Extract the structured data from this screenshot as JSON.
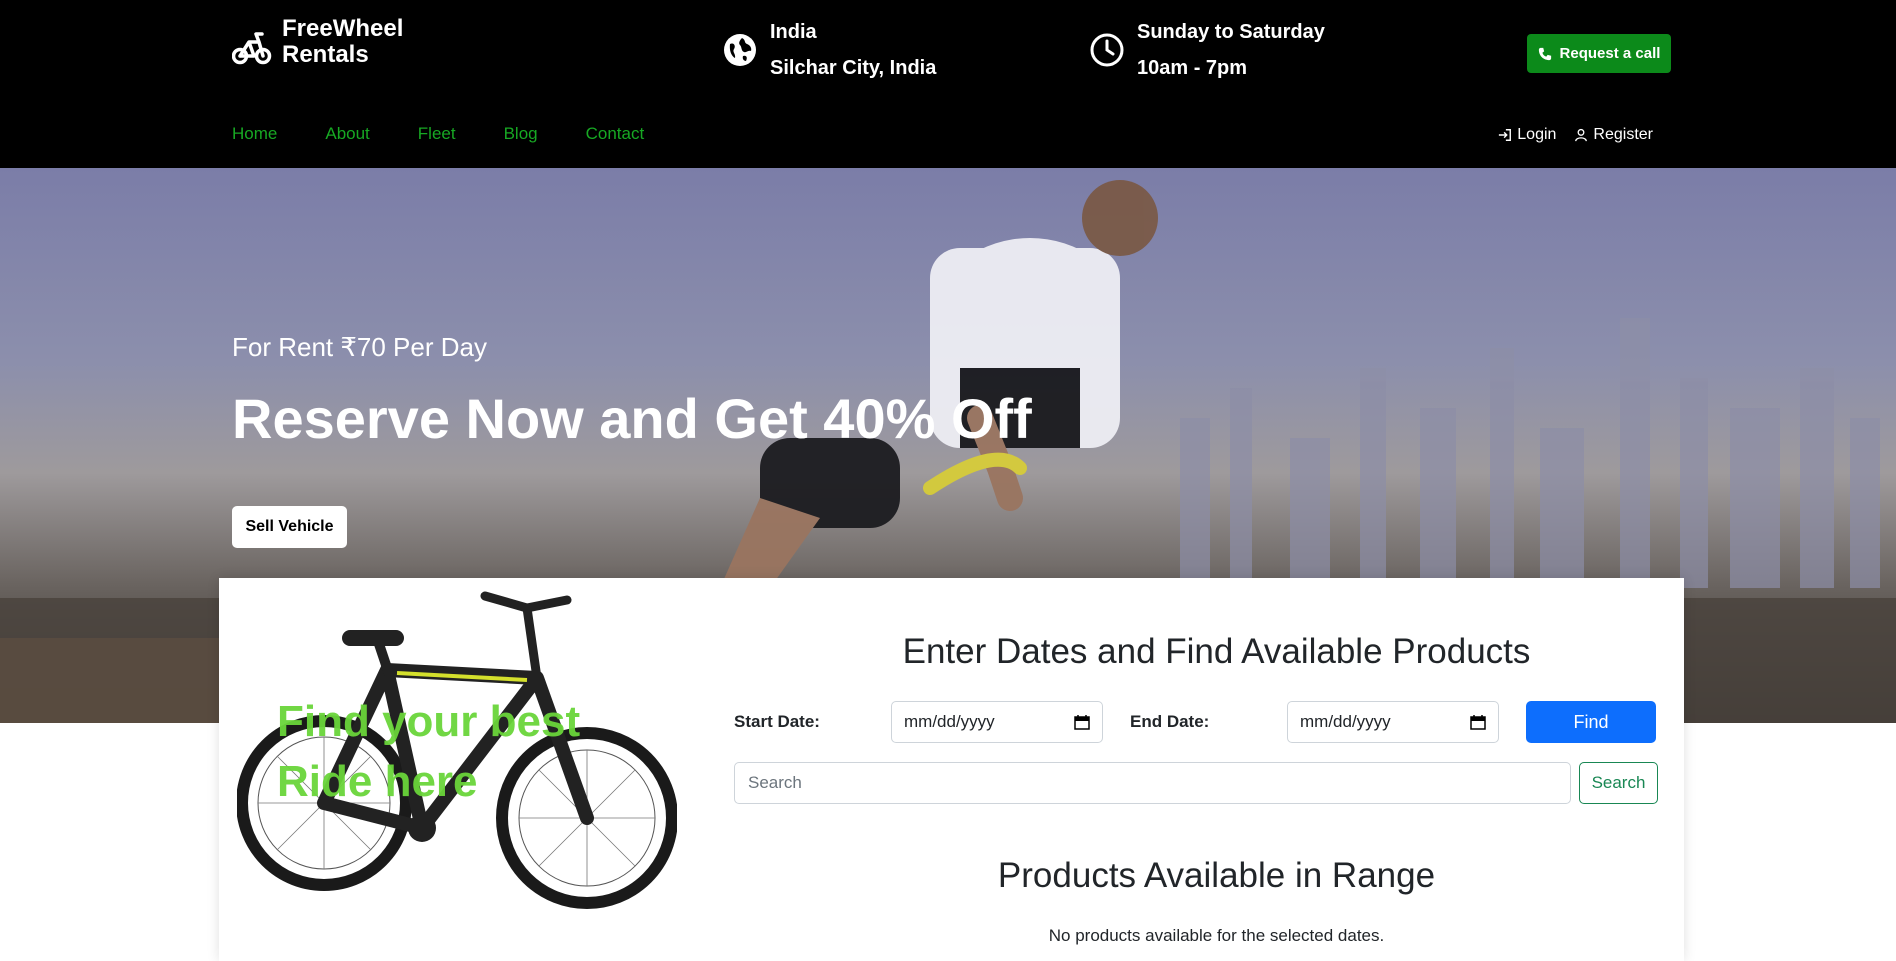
{
  "brand": {
    "name": "FreeWheel Rentals",
    "icon": "bicycle-icon"
  },
  "location": {
    "country": "India",
    "city": "Silchar City, India",
    "icon": "globe-icon"
  },
  "hours": {
    "days": "Sunday to Saturday",
    "time": "10am - 7pm",
    "icon": "clock-icon"
  },
  "header": {
    "call_label": "Request a call",
    "call_icon": "phone-icon"
  },
  "nav": {
    "items": [
      {
        "label": "Home"
      },
      {
        "label": "About"
      },
      {
        "label": "Fleet"
      },
      {
        "label": "Blog"
      },
      {
        "label": "Contact"
      }
    ]
  },
  "auth": {
    "login": "Login",
    "register": "Register"
  },
  "hero": {
    "subtitle": "For Rent ₹70 Per Day",
    "title": "Reserve Now and Get 40% Off",
    "sell_label": "Sell Vehicle"
  },
  "finder": {
    "image_caption": "Find your best Ride here",
    "title": "Enter Dates and Find Available Products",
    "start_label": "Start Date:",
    "start_placeholder": "mm/dd/yyyy",
    "end_label": "End Date:",
    "end_placeholder": "mm/dd/yyyy",
    "find_label": "Find",
    "search_placeholder": "Search",
    "search_label": "Search"
  },
  "results": {
    "title": "Products Available in Range",
    "empty_message": "No products available for the selected dates."
  },
  "colors": {
    "nav_link": "#17a823",
    "call_button": "#0c8a1a",
    "find_button": "#0d6efd",
    "search_button": "#198754",
    "caption": "#6ad53a"
  }
}
